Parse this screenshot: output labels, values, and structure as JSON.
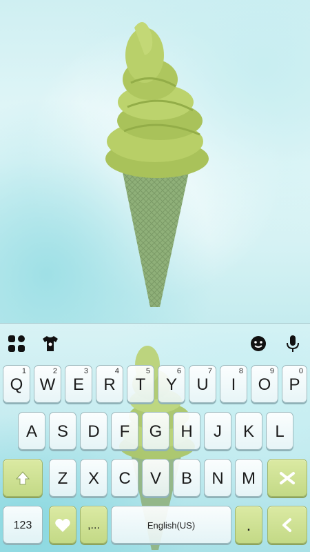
{
  "toolbar": {
    "icons": [
      "apps-icon",
      "theme-shirt-icon",
      "emoji-icon",
      "microphone-icon"
    ]
  },
  "keyboard": {
    "row1": [
      {
        "label": "Q",
        "hint": "1"
      },
      {
        "label": "W",
        "hint": "2"
      },
      {
        "label": "E",
        "hint": "3"
      },
      {
        "label": "R",
        "hint": "4"
      },
      {
        "label": "T",
        "hint": "5"
      },
      {
        "label": "Y",
        "hint": "6"
      },
      {
        "label": "U",
        "hint": "7"
      },
      {
        "label": "I",
        "hint": "8"
      },
      {
        "label": "O",
        "hint": "9"
      },
      {
        "label": "P",
        "hint": "0"
      }
    ],
    "row2": [
      "A",
      "S",
      "D",
      "F",
      "G",
      "H",
      "J",
      "K",
      "L"
    ],
    "row3": [
      "Z",
      "X",
      "C",
      "V",
      "B",
      "N",
      "M"
    ],
    "numbers_label": "123",
    "comma_label": ",...",
    "space_label": "English(US)",
    "period_label": "."
  },
  "colors": {
    "accent_green": "#c3d986",
    "background": "#bfe9ee"
  }
}
